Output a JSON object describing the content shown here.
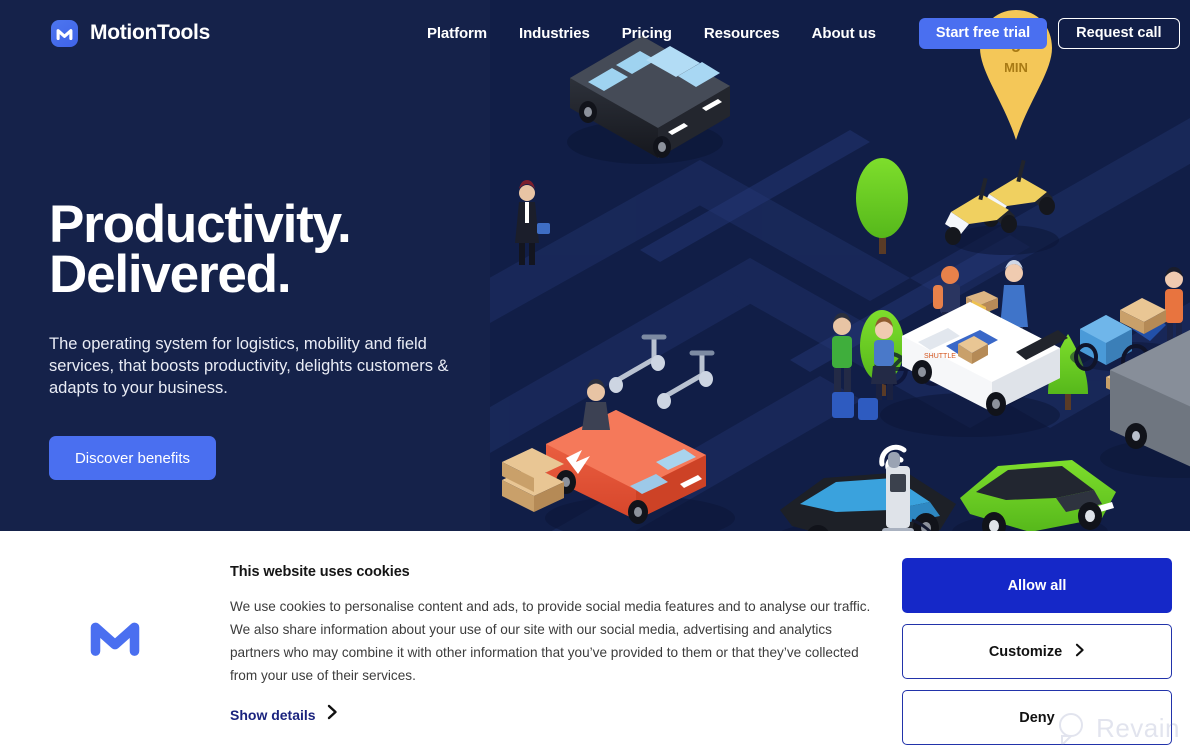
{
  "brand": {
    "name": "MotionTools",
    "logo_icon": "motiontools-m-logo",
    "logo_color": "#4a6ff0"
  },
  "header": {
    "nav_items": [
      {
        "label": "Platform"
      },
      {
        "label": "Industries"
      },
      {
        "label": "Pricing"
      },
      {
        "label": "Resources"
      },
      {
        "label": "About us"
      }
    ],
    "primary_cta": "Start free trial",
    "secondary_cta": "Request call",
    "background_color": "#15224a",
    "accent_color": "#4a6ff0"
  },
  "hero": {
    "title_line1": "Productivity.",
    "title_line2": "Delivered.",
    "subtitle": "The operating system for logistics, mobility and field services, that boosts productivity, delights customers & adapts to your business.",
    "cta_label": "Discover benefits",
    "illustration": {
      "description": "Isometric night city map with delivery vehicles, people and trees",
      "map_pin_label_line1": "5",
      "map_pin_label_line2": "MIN",
      "pin_color": "#f2c14e",
      "vehicles": [
        "black passenger van",
        "orange delivery van",
        "white autonomous shuttle",
        "black taxi car with wifi roof sign",
        "green electric car at charging station",
        "grey electric truck with lightning bolt",
        "two yellow scooters",
        "blue cargo bike",
        "kick scooters"
      ],
      "background_color": "#111e47",
      "road_color": "#1c2c5e",
      "tree_color": "#5ed22b"
    }
  },
  "cookie_banner": {
    "logo_icon": "motiontools-m-logo",
    "title": "This website uses cookies",
    "body": "We use cookies to personalise content and ads, to provide social media features and to analyse our traffic. We also share information about your use of our site with our social media, advertising and analytics partners who may combine it with other information that you’ve provided to them or that they’ve collected from your use of their services.",
    "show_details_label": "Show details",
    "buttons": [
      {
        "label": "Allow all",
        "style": "filled",
        "chevron": false
      },
      {
        "label": "Customize",
        "style": "outline",
        "chevron": true
      },
      {
        "label": "Deny",
        "style": "outline",
        "chevron": false
      }
    ],
    "background_color": "#ffffff",
    "filled_button_color": "#1528c8",
    "outline_border_color": "#2233aa"
  },
  "watermark": {
    "label": "Revain"
  }
}
